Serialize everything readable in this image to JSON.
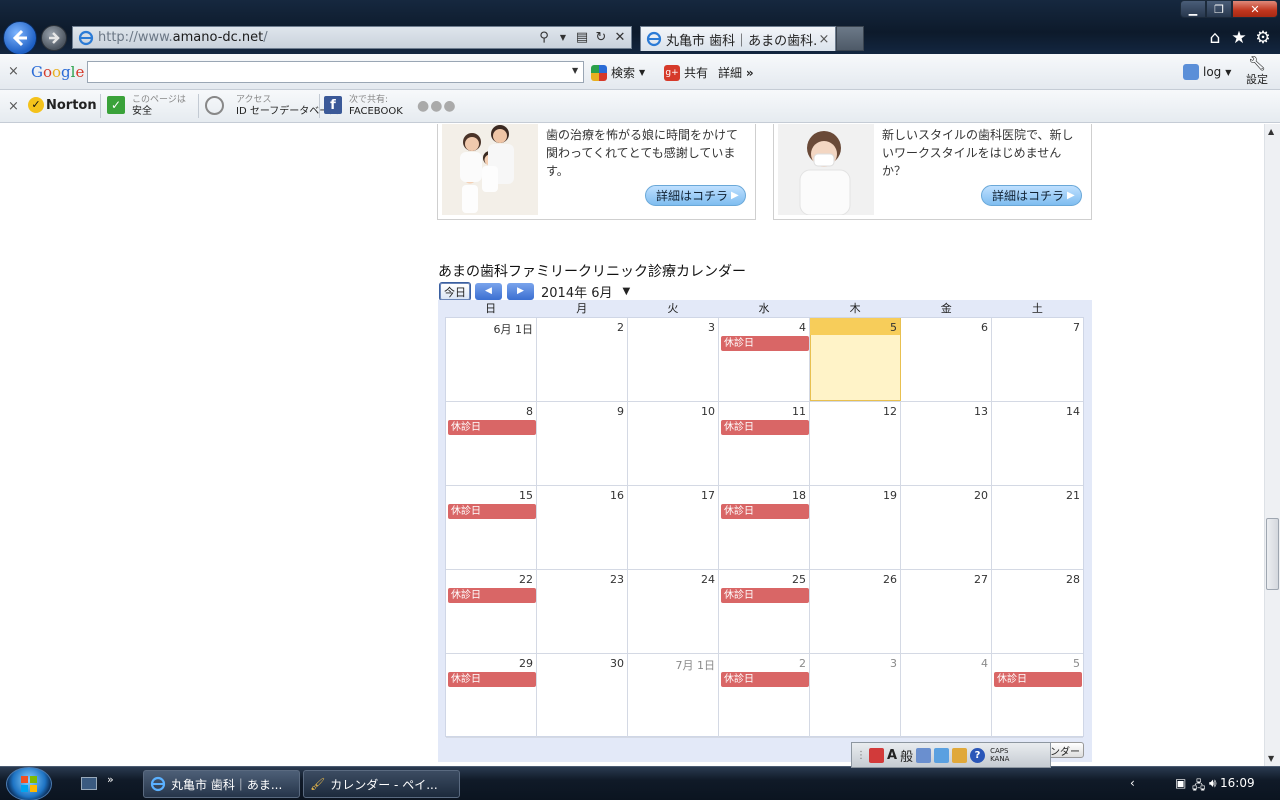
{
  "browser": {
    "url_prefix": "http://www.",
    "url_domain": "amano-dc.net",
    "url_suffix": "/",
    "tab_title": "丸亀市 歯科｜あまの歯科...",
    "tab_close": "×"
  },
  "google_bar": {
    "close": "×",
    "logo": "Google",
    "search_label": "検索",
    "share_label": "共有",
    "more_label": "詳細",
    "more_arrows": "»",
    "user_label": "log",
    "settings_label": "設定"
  },
  "norton_bar": {
    "close": "×",
    "logo": "Norton",
    "safe_small": "このページは",
    "safe_label": "安全",
    "id_small": "アクセス",
    "id_label": "ID セーフデータベース",
    "share_small": "次で共有:",
    "share_label": "FACEBOOK"
  },
  "cards": [
    {
      "text": "歯の治療を怖がる娘に時間をかけて関わってくれてとても感謝しています。",
      "button": "詳細はコチラ"
    },
    {
      "text": "新しいスタイルの歯科医院で、新しいワークスタイルをはじめませんか？",
      "button": "詳細はコチラ"
    }
  ],
  "calendar": {
    "title": "あまの歯科ファミリークリニック診療カレンダー",
    "today_btn": "今日",
    "month_label": "2014年 6月",
    "weekdays": [
      "日",
      "月",
      "火",
      "水",
      "木",
      "金",
      "土"
    ],
    "event_label": "休診日",
    "weeks": [
      [
        {
          "d": "6月 1日",
          "ev": false
        },
        {
          "d": "2",
          "ev": false
        },
        {
          "d": "3",
          "ev": false
        },
        {
          "d": "4",
          "ev": true
        },
        {
          "d": "5",
          "ev": false,
          "today": true
        },
        {
          "d": "6",
          "ev": false
        },
        {
          "d": "7",
          "ev": false
        }
      ],
      [
        {
          "d": "8",
          "ev": true
        },
        {
          "d": "9",
          "ev": false
        },
        {
          "d": "10",
          "ev": false
        },
        {
          "d": "11",
          "ev": true
        },
        {
          "d": "12",
          "ev": false
        },
        {
          "d": "13",
          "ev": false
        },
        {
          "d": "14",
          "ev": false
        }
      ],
      [
        {
          "d": "15",
          "ev": true
        },
        {
          "d": "16",
          "ev": false
        },
        {
          "d": "17",
          "ev": false
        },
        {
          "d": "18",
          "ev": true
        },
        {
          "d": "19",
          "ev": false
        },
        {
          "d": "20",
          "ev": false
        },
        {
          "d": "21",
          "ev": false
        }
      ],
      [
        {
          "d": "22",
          "ev": true
        },
        {
          "d": "23",
          "ev": false
        },
        {
          "d": "24",
          "ev": false
        },
        {
          "d": "25",
          "ev": true
        },
        {
          "d": "26",
          "ev": false
        },
        {
          "d": "27",
          "ev": false
        },
        {
          "d": "28",
          "ev": false
        }
      ],
      [
        {
          "d": "29",
          "ev": true
        },
        {
          "d": "30",
          "ev": false
        },
        {
          "d": "7月 1日",
          "ev": false,
          "other": true
        },
        {
          "d": "2",
          "ev": true,
          "other": true
        },
        {
          "d": "3",
          "ev": false,
          "other": true
        },
        {
          "d": "4",
          "ev": false,
          "other": true
        },
        {
          "d": "5",
          "ev": true,
          "other": true
        }
      ]
    ],
    "footer_btn": "ンダー"
  },
  "ime": {
    "han": "般",
    "a": "A",
    "caps": "CAPS",
    "kana": "KANA"
  },
  "taskbar": {
    "task1": "丸亀市 歯科｜あま...",
    "task2": "カレンダー - ペイ...",
    "clock": "16:09"
  },
  "colors": {
    "event": "#d96666",
    "today": "#fff3c8",
    "calendar_bg": "#e3e9f8",
    "more_btn": "#7fbdf0"
  }
}
